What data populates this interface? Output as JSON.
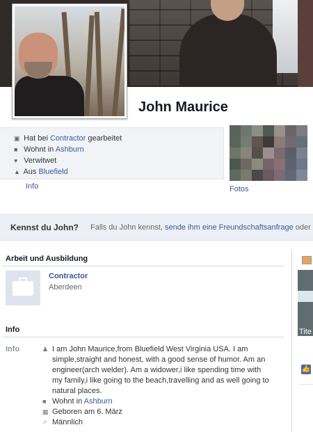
{
  "profile": {
    "name": "John Maurice"
  },
  "info_box": {
    "work": {
      "prefix": "Hat bei",
      "link": "Contractor",
      "suffix": "gearbeitet"
    },
    "lives": {
      "prefix": "Wohnt in",
      "link": "Ashburn"
    },
    "relationship": "Verwitwet",
    "from": {
      "prefix": "Aus",
      "link": "Bluefield"
    }
  },
  "tabs": {
    "info": "Info",
    "photos": "Fotos"
  },
  "know_bar": {
    "question": "Kennst du John?",
    "text_before": "Falls du John kennst,",
    "link": "sende ihm eine Freundschaftsanfrage",
    "text_after": "oder se"
  },
  "work_section": {
    "title": "Arbeit und Ausbildung",
    "employer": "Contractor",
    "location": "Aberdeen"
  },
  "info_section": {
    "title": "Info",
    "label": "Info",
    "bio": "I am John Maurice,from Bluefield West Virginia USA. I am simple,straight and honest, with a good sense of humor. Am an engineer(arch welder). Am a widower,i like spending time with my family,i like going to the beach,travelling and as well going to natural places.",
    "lives_prefix": "Wohnt in",
    "lives_link": "Ashburn",
    "birthday": "Geboren am 6. März",
    "gender": "Männlich"
  },
  "right_column": {
    "caption": "Tite"
  },
  "icons": {
    "work": "briefcase-icon",
    "home": "house-icon",
    "heart": "heart-icon",
    "from": "hometown-icon",
    "bio": "person-icon",
    "calendar": "calendar-icon",
    "gender": "male-icon",
    "like": "thumbs-up-icon"
  },
  "colors": {
    "link": "#3b5998",
    "bar_bg": "#eceff5",
    "info_bg": "#f2f3f7"
  }
}
